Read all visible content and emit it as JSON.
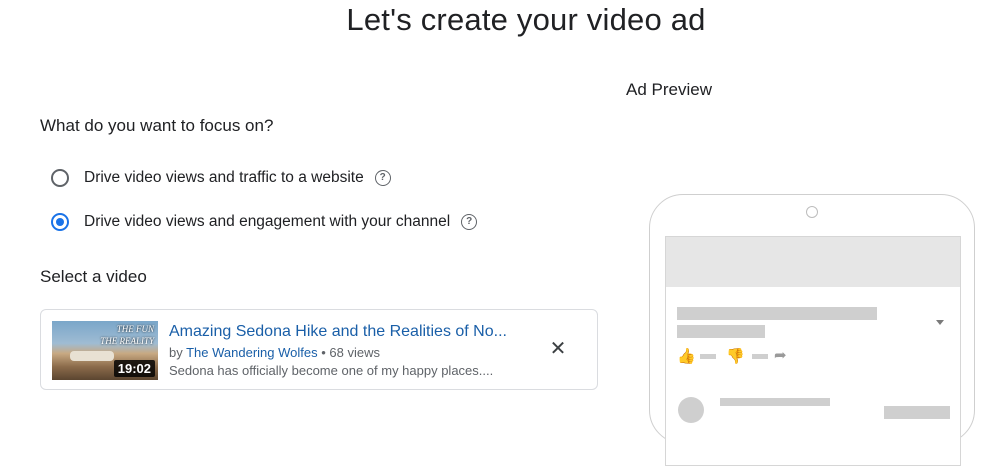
{
  "page": {
    "title": "Let's create your video ad"
  },
  "focus": {
    "question": "What do you want to focus on?",
    "options": [
      {
        "label": "Drive video views and traffic to a website",
        "selected": false
      },
      {
        "label": "Drive video views and engagement with your channel",
        "selected": true
      }
    ],
    "help_icon": "question-circle-icon"
  },
  "video_select": {
    "label": "Select a video",
    "video": {
      "title": "Amazing Sedona Hike and the Realities of No...",
      "by_prefix": "by ",
      "channel": "The Wandering Wolfes",
      "views": " • 68 views",
      "description": "Sedona has officially become one of my happy places....",
      "duration": "19:02",
      "thumbnail_text": [
        "THE FUN",
        "THE REALITY"
      ],
      "close_icon": "close-icon"
    }
  },
  "preview": {
    "label": "Ad Preview",
    "icons": [
      "thumbs-up-icon",
      "thumbs-down-icon",
      "share-icon",
      "dropdown-icon"
    ]
  }
}
